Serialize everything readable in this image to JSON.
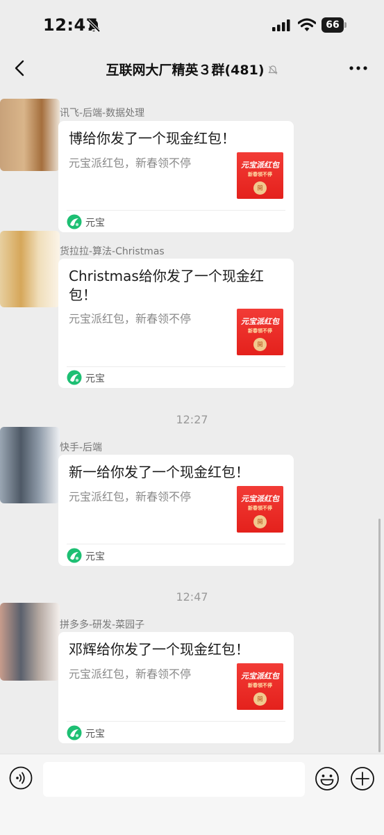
{
  "status_bar": {
    "time": "12:47",
    "battery": "66",
    "icons": [
      "bell-slash-icon",
      "signal-icon",
      "wifi-icon",
      "battery-icon"
    ]
  },
  "nav": {
    "title": "互联网大厂精英３群(481)",
    "back_icon": "chevron-left-icon",
    "mute_icon": "bell-slash-icon",
    "more_icon": "ellipsis-icon"
  },
  "messages": [
    {
      "sender": "讯飞-后端-数据处理",
      "title": "博给你发了一个现金红包！",
      "desc": "元宝派红包，新春领不停",
      "envelope": {
        "brand": "元宝派红包",
        "slogan": "新春领不停",
        "seal": "開"
      },
      "footer": "元宝"
    },
    {
      "sender": "货拉拉-算法-Christmas",
      "title": "Christmas给你发了一个现金红包！",
      "desc": "元宝派红包，新春领不停",
      "envelope": {
        "brand": "元宝派红包",
        "slogan": "新春领不停",
        "seal": "開"
      },
      "footer": "元宝"
    },
    {
      "time_divider": "12:27",
      "sender": "快手-后端",
      "title": "新一给你发了一个现金红包！",
      "desc": "元宝派红包，新春领不停",
      "envelope": {
        "brand": "元宝派红包",
        "slogan": "新春领不停",
        "seal": "開"
      },
      "footer": "元宝"
    },
    {
      "time_divider": "12:47",
      "sender": "拼多多-研发-菜园子",
      "title": "邓辉给你发了一个现金红包！",
      "desc": "元宝派红包，新春领不停",
      "envelope": {
        "brand": "元宝派红包",
        "slogan": "新春领不停",
        "seal": "開"
      },
      "footer": "元宝"
    }
  ],
  "input_bar": {
    "voice_icon": "voice-icon",
    "placeholder": "",
    "emoji_icon": "emoji-icon",
    "plus_icon": "plus-icon"
  },
  "colors": {
    "background": "#ededed",
    "card": "#ffffff",
    "envelope_red": "#e4211c",
    "seal_gold": "#f1c98e",
    "yuanbao_green": "#1dbf73"
  }
}
